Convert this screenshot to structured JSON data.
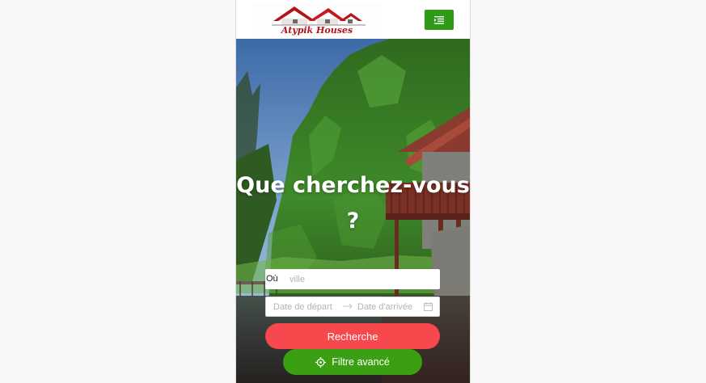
{
  "header": {
    "logo_text": "Atypik Houses",
    "menu_icon": "menu-list-icon"
  },
  "hero": {
    "title": "Que cherchez-vous ?"
  },
  "search": {
    "where_label": "Où",
    "where_placeholder": "ville",
    "date_start_placeholder": "Date de départ",
    "date_end_placeholder": "Date d'arrivée",
    "search_button": "Recherche",
    "filter_button": "Filtre avancé"
  },
  "colors": {
    "brand_green": "#2f9a17",
    "search_red": "#f7494d",
    "filter_green": "#3b9f13",
    "logo_red": "#b3141a"
  }
}
